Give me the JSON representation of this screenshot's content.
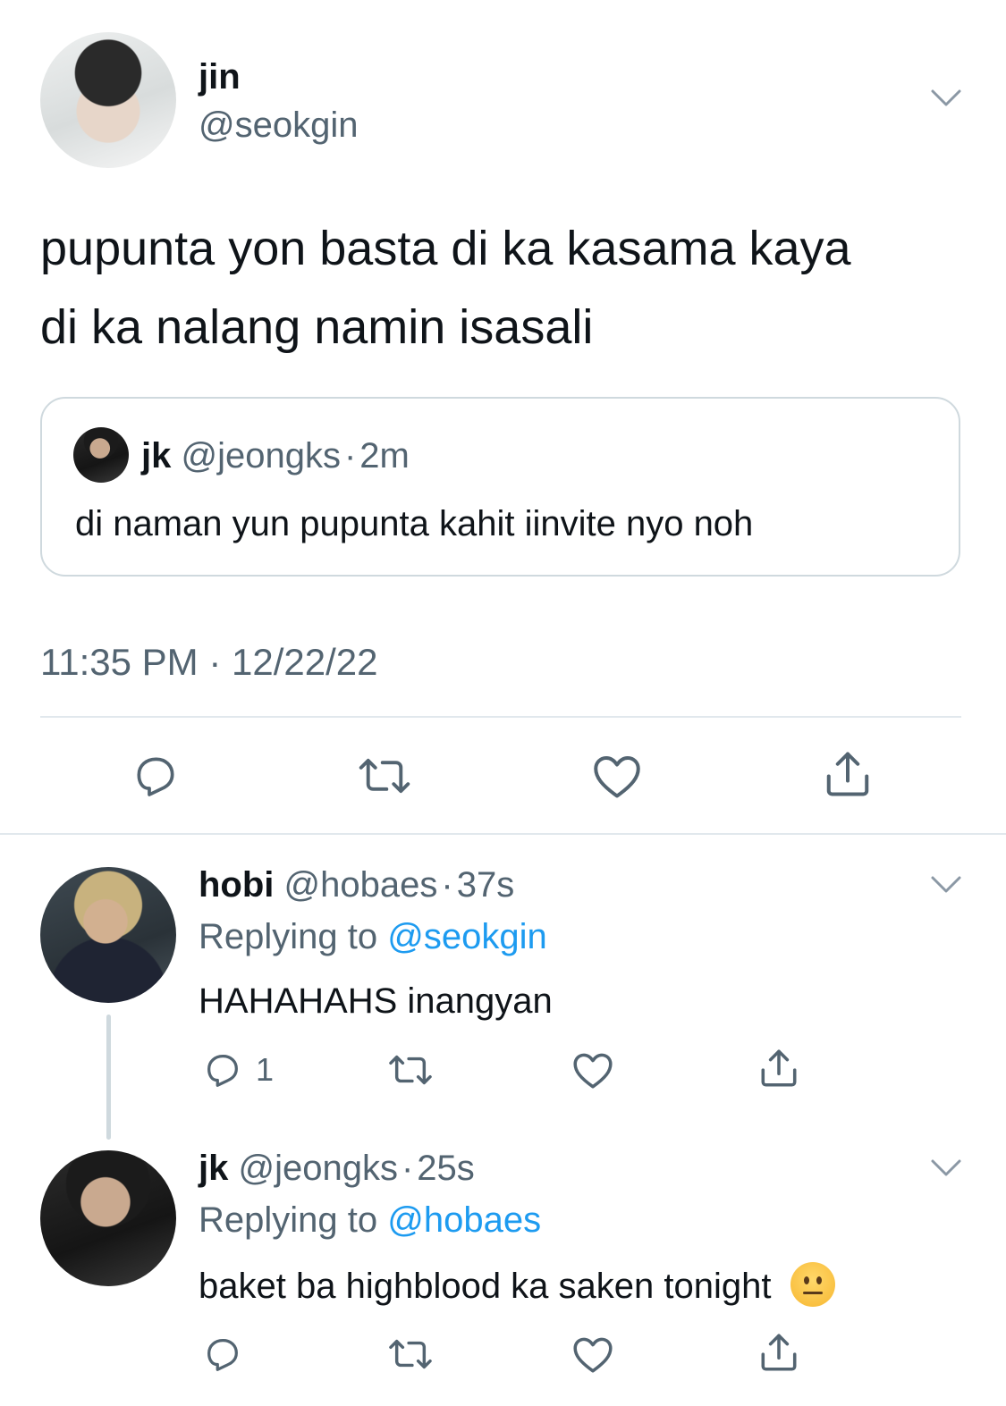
{
  "main_tweet": {
    "author_name": "jin",
    "author_handle": "@seokgin",
    "text_line1": "pupunta yon basta di ka kasama kaya",
    "text_line2": "di ka nalang namin isasali",
    "quoted": {
      "author_name": "jk",
      "author_handle": "@jeongks",
      "separator": "·",
      "time": "2m",
      "text": "di naman yun pupunta kahit iinvite nyo noh"
    },
    "timestamp": "11:35 PM · 12/22/22"
  },
  "replies": [
    {
      "author_name": "hobi",
      "author_handle": "@hobaes",
      "separator": "·",
      "time": "37s",
      "replying_prefix": "Replying to",
      "replying_handle": "@seokgin",
      "text": "HAHAHAHS inangyan",
      "reply_count": "1"
    },
    {
      "author_name": "jk",
      "author_handle": "@jeongks",
      "separator": "·",
      "time": "25s",
      "replying_prefix": "Replying to",
      "replying_handle": "@hobaes",
      "text": "baket ba highblood ka saken tonight",
      "emoji": "😐"
    }
  ],
  "colors": {
    "text": "#0f1419",
    "secondary": "#536471",
    "link": "#1d9bf0",
    "divider": "#cfd9de"
  }
}
